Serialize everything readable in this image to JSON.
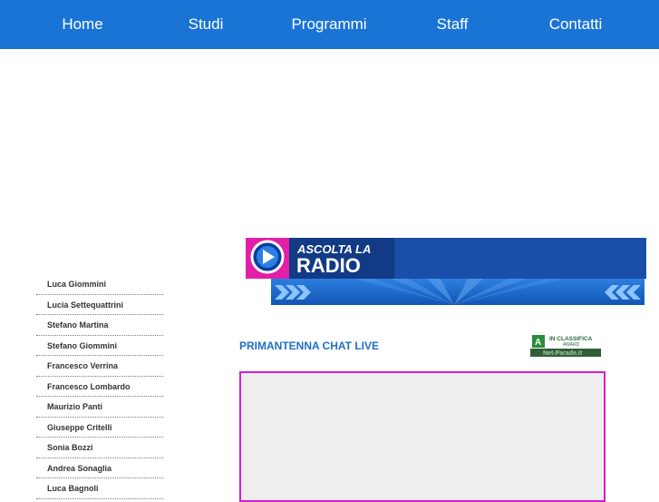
{
  "nav": {
    "items": [
      {
        "label": "Home"
      },
      {
        "label": "Studi"
      },
      {
        "label": "Programmi"
      },
      {
        "label": "Staff"
      },
      {
        "label": "Contatti"
      }
    ]
  },
  "staff": [
    "Luca Giommini",
    "Lucia Settequattrini",
    "Stefano Martina",
    "Stefano Giommini",
    "Francesco Verrina",
    "Francesco Lombardo",
    "Maurizio Panti",
    "Giuseppe Critelli",
    "Sonia Bozzi",
    "Andrea Sonaglia",
    "Luca Bagnoli"
  ],
  "radio_banner": {
    "line1": "ASCOLTA LA",
    "line2": "RADIO"
  },
  "chat": {
    "title": "PRIMANTENNA CHAT LIVE"
  },
  "award": {
    "line1": "IN CLASSIFICA",
    "line2": "AWARD",
    "site": "Net-Parade.it"
  },
  "colors": {
    "nav_bg": "#1a74d6",
    "accent": "#1f6fc8",
    "chat_border": "#d21fd2",
    "banner_magenta": "#e21fa8"
  }
}
